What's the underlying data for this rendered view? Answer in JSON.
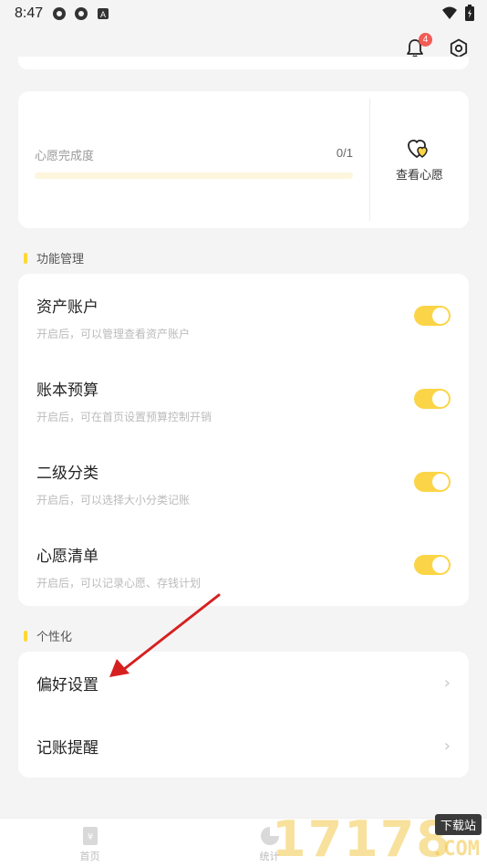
{
  "status_bar": {
    "time": "8:47"
  },
  "header": {
    "notification_count": "4"
  },
  "wish": {
    "label": "心愿完成度",
    "count": "0/1",
    "progress": 0,
    "view_label": "查看心愿"
  },
  "sections": {
    "features_title": "功能管理",
    "personal_title": "个性化"
  },
  "features": [
    {
      "title": "资产账户",
      "desc": "开启后，可以管理查看资产账户",
      "enabled": true
    },
    {
      "title": "账本预算",
      "desc": "开启后，可在首页设置预算控制开销",
      "enabled": true
    },
    {
      "title": "二级分类",
      "desc": "开启后，可以选择大小分类记账",
      "enabled": true
    },
    {
      "title": "心愿清单",
      "desc": "开启后，可以记录心愿、存钱计划",
      "enabled": true
    }
  ],
  "personal": [
    {
      "label": "偏好设置"
    },
    {
      "label": "记账提醒"
    }
  ],
  "bottom_nav": [
    {
      "label": "首页",
      "icon": "ledger-icon"
    },
    {
      "label": "统计",
      "icon": "pie-chart-icon"
    }
  ],
  "watermark": {
    "digits": "17178",
    "tag": "下载站",
    "domain": ".COM"
  },
  "colors": {
    "accent": "#fbd547",
    "badge": "#f25c54",
    "arrow": "#d62020"
  }
}
